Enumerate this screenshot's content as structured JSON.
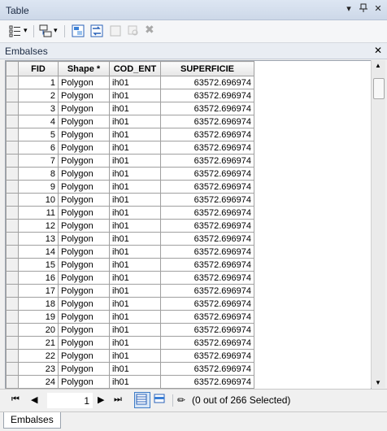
{
  "window": {
    "title": "Table"
  },
  "tab_header": {
    "label": "Embalses"
  },
  "table": {
    "columns": [
      "FID",
      "Shape *",
      "COD_ENT",
      "SUPERFICIE"
    ],
    "rows": [
      [
        "1",
        "Polygon",
        "ih01",
        "63572.696974"
      ],
      [
        "2",
        "Polygon",
        "ih01",
        "63572.696974"
      ],
      [
        "3",
        "Polygon",
        "ih01",
        "63572.696974"
      ],
      [
        "4",
        "Polygon",
        "ih01",
        "63572.696974"
      ],
      [
        "5",
        "Polygon",
        "ih01",
        "63572.696974"
      ],
      [
        "6",
        "Polygon",
        "ih01",
        "63572.696974"
      ],
      [
        "7",
        "Polygon",
        "ih01",
        "63572.696974"
      ],
      [
        "8",
        "Polygon",
        "ih01",
        "63572.696974"
      ],
      [
        "9",
        "Polygon",
        "ih01",
        "63572.696974"
      ],
      [
        "10",
        "Polygon",
        "ih01",
        "63572.696974"
      ],
      [
        "11",
        "Polygon",
        "ih01",
        "63572.696974"
      ],
      [
        "12",
        "Polygon",
        "ih01",
        "63572.696974"
      ],
      [
        "13",
        "Polygon",
        "ih01",
        "63572.696974"
      ],
      [
        "14",
        "Polygon",
        "ih01",
        "63572.696974"
      ],
      [
        "15",
        "Polygon",
        "ih01",
        "63572.696974"
      ],
      [
        "16",
        "Polygon",
        "ih01",
        "63572.696974"
      ],
      [
        "17",
        "Polygon",
        "ih01",
        "63572.696974"
      ],
      [
        "18",
        "Polygon",
        "ih01",
        "63572.696974"
      ],
      [
        "19",
        "Polygon",
        "ih01",
        "63572.696974"
      ],
      [
        "20",
        "Polygon",
        "ih01",
        "63572.696974"
      ],
      [
        "21",
        "Polygon",
        "ih01",
        "63572.696974"
      ],
      [
        "22",
        "Polygon",
        "ih01",
        "63572.696974"
      ],
      [
        "23",
        "Polygon",
        "ih01",
        "63572.696974"
      ],
      [
        "24",
        "Polygon",
        "ih01",
        "63572.696974"
      ]
    ]
  },
  "navigation": {
    "current_record": "1",
    "selection_status": "(0 out of 266 Selected)"
  },
  "bottom_tabs": [
    {
      "label": "Embalses"
    }
  ],
  "colors": {
    "titlebar": "#dde6f3",
    "active_view": "#3e7cc7"
  }
}
